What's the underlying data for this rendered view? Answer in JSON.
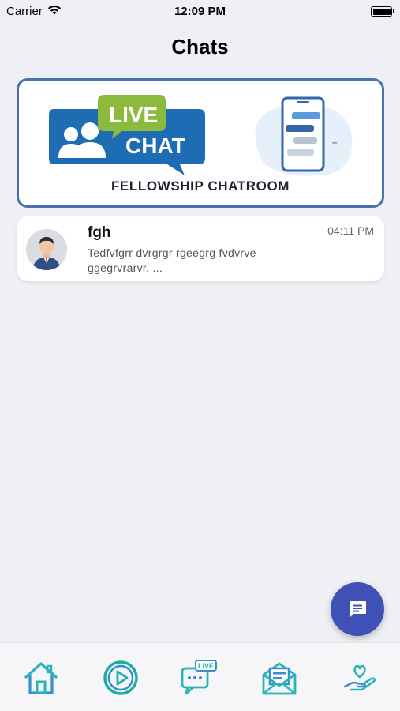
{
  "status_bar": {
    "carrier": "Carrier",
    "time": "12:09 PM"
  },
  "header": {
    "title": "Chats"
  },
  "banner": {
    "logo_word_1": "LIVE",
    "logo_word_2": "CHAT",
    "caption": "FELLOWSHIP CHATROOM"
  },
  "chats": [
    {
      "name": "fgh",
      "time": "04:11 PM",
      "preview": "Tedfvfgrr dvrgrgr rgeegrg fvdvrve ggegrvrarvr. ..."
    }
  ],
  "tab_bar": {
    "tabs": [
      {
        "icon": "home-icon"
      },
      {
        "icon": "play-circle-icon"
      },
      {
        "icon": "live-chat-icon",
        "badge": "LIVE"
      },
      {
        "icon": "mail-icon"
      },
      {
        "icon": "heart-hand-icon"
      }
    ]
  },
  "colors": {
    "accent": "#3f51b5",
    "banner_border": "#4a72ad",
    "tab_teal": "#2bb3b8",
    "background": "#eef0f5"
  }
}
